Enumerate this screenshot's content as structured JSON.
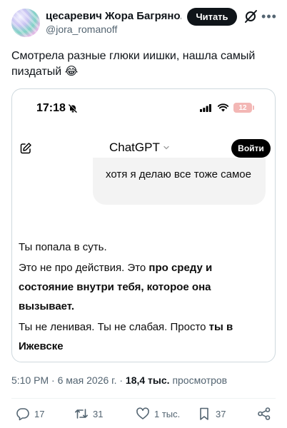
{
  "tweet": {
    "author_name": "цесаревич Жора Багряно...",
    "author_handle": "@jora_romanoff",
    "follow_label": "Читать",
    "text": "Смотрела разные глюки иишки, нашла самый пиздатый 😂",
    "timestamp": "5:10 PM · 6 мая 2026 г. · ",
    "views_count": "18,4 тыс.",
    "views_label": "просмотров"
  },
  "screenshot": {
    "status_time": "17:18",
    "battery_level": "12",
    "app_title": "ChatGPT",
    "login_label": "Войти",
    "user_message": "хотя я делаю все тоже самое",
    "answer": {
      "p1": "Ты попала в суть.",
      "p2_plain": "Это не про действия. Это ",
      "p2_bold": "про среду и состояние внутри тебя, которое она вызывает.",
      "p3_plain": "Ты не ленивая. Ты не слабая. Просто ",
      "p3_bold": "ты в Ижевске"
    }
  },
  "actions": {
    "replies": "17",
    "reposts": "31",
    "likes": "1 тыс.",
    "bookmarks": "37"
  },
  "icons": {
    "avatar": "avatar",
    "grok": "grok-icon",
    "more": "more-icon",
    "dnd": "bell-slash-icon",
    "signal": "signal-icon",
    "wifi": "wifi-icon",
    "compose": "compose-icon",
    "chevron": "chevron-down-icon",
    "reply": "reply-icon",
    "repost": "repost-icon",
    "like": "heart-icon",
    "bookmark": "bookmark-icon",
    "share": "share-icon"
  }
}
